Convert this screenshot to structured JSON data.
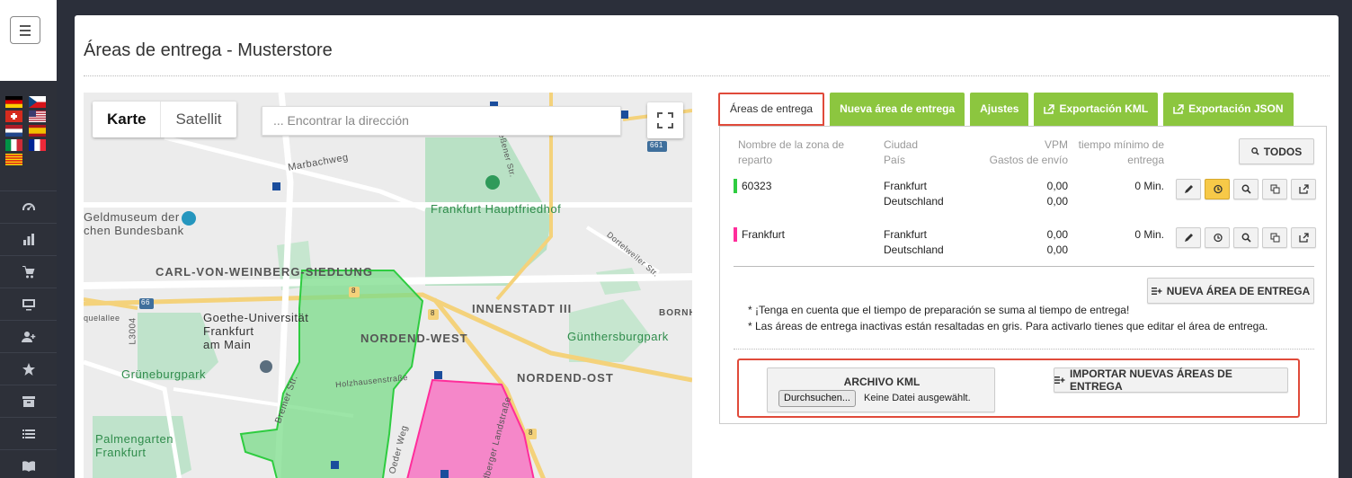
{
  "page": {
    "title": "Áreas de entrega - Musterstore"
  },
  "map": {
    "type_map": "Karte",
    "type_satellite": "Satellit",
    "search_placeholder": "... Encontrar la dirección",
    "labels": {
      "geldmuseum1": "Geldmuseum der",
      "geldmuseum2": "chen Bundesbank",
      "marbachweg": "Marbachweg",
      "hauptfriedhof": "Frankfurt Hauptfriedhof",
      "weinberg": "CARL-VON-WEINBERG-SIEDLUNG",
      "goethe1": "Goethe-Universität",
      "goethe2": "Frankfurt",
      "goethe3": "am Main",
      "innenstadt": "INNENSTADT III",
      "nordend_west": "NORDEND-WEST",
      "guenthersburg": "Günthersburgpark",
      "grueneburg": "Grüneburgpark",
      "nordend_ost": "NORDEND-OST",
      "palmengarten1": "Palmengarten",
      "palmengarten2": "Frankfurt",
      "holzhausen": "Holzhausenstraße",
      "bornh": "BORNH",
      "road_661": "661",
      "road_66": "66",
      "road_l3004": "L3004",
      "quelallee": "quelallee",
      "road_8a": "8",
      "road_8b": "8",
      "road_8c": "8",
      "bremer": "Bremer Str.",
      "oeder": "Oeder Weg",
      "friedberger": "dberger Landstraße",
      "giessener": "Gießener Str.",
      "dortelweiler": "Dortelweiler Str.",
      "metro_u": "U"
    }
  },
  "tabs": {
    "areas": "Áreas de entrega",
    "new_area": "Nueva área de entrega",
    "settings": "Ajustes",
    "export_kml": "Exportación KML",
    "export_json": "Exportación JSON"
  },
  "table": {
    "headers": {
      "name_line1": "Nombre de la zona de",
      "name_line2": "reparto",
      "city": "Ciudad",
      "country": "País",
      "vpm": "VPM",
      "shipping": "Gastos de envío",
      "time_line1": "tiempo mínimo de",
      "time_line2": "entrega"
    },
    "all_button": "TODOS",
    "rows": [
      {
        "name": "60323",
        "city": "Frankfurt",
        "country": "Deutschland",
        "vpm": "0,00",
        "shipping": "0,00",
        "time": "0 Min.",
        "color": "#2ecc40"
      },
      {
        "name": "Frankfurt",
        "city": "Frankfurt",
        "country": "Deutschland",
        "vpm": "0,00",
        "shipping": "0,00",
        "time": "0 Min.",
        "color": "#ff2d9b"
      }
    ]
  },
  "new_area_button": "NUEVA ÁREA DE ENTREGA",
  "notes": {
    "note1": "* ¡Tenga en cuenta que el tiempo de preparación se suma al tiempo de entrega!",
    "note2": "* Las áreas de entrega inactivas están resaltadas en gris. Para activarlo tienes que editar el área de entrega."
  },
  "import": {
    "file_title": "ARCHIVO KML",
    "browse": "Durchsuchen...",
    "no_file": "Keine Datei ausgewählt.",
    "import_button": "IMPORTAR NUEVAS ÁREAS DE ENTREGA"
  },
  "colors": {
    "accent_green": "#8cc63f",
    "highlight_red": "#e04a3a",
    "zone_green": "#2ecc40",
    "zone_pink": "#ff2d9b"
  }
}
